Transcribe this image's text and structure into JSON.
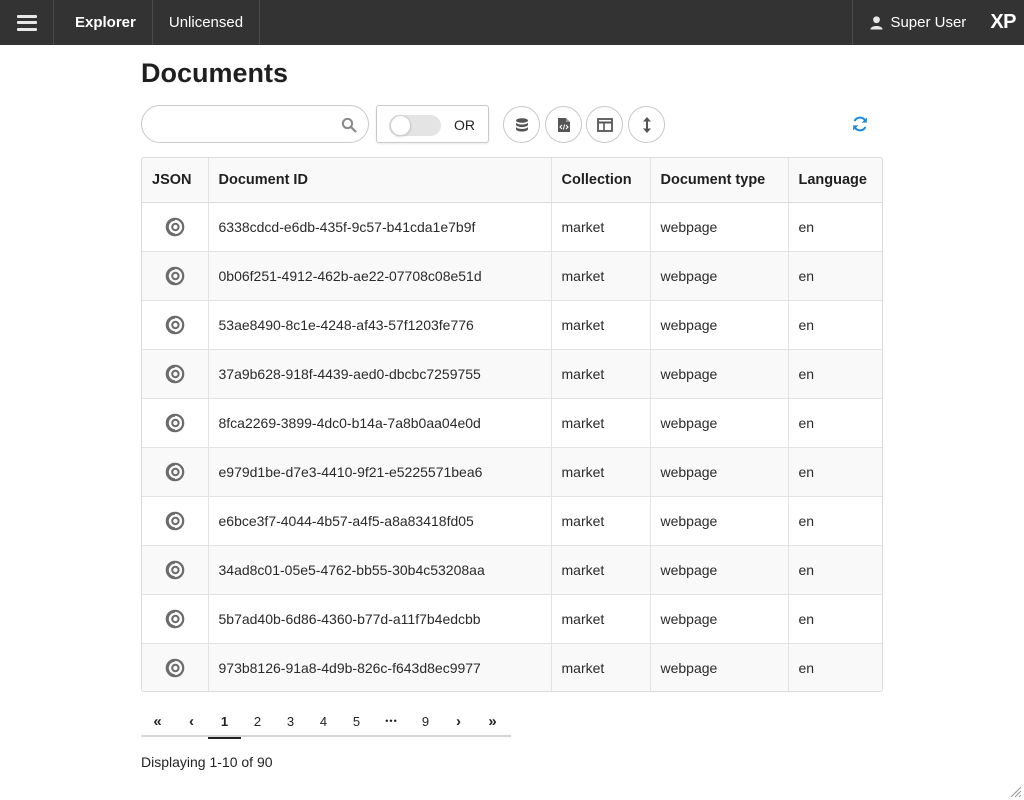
{
  "topbar": {
    "app_name": "Explorer",
    "license": "Unlicensed",
    "user": "Super User",
    "logo": "XP",
    "menu_icon": "hamburger-icon",
    "user_icon": "user-icon"
  },
  "page": {
    "title": "Documents"
  },
  "search": {
    "value": "",
    "placeholder": "",
    "icon": "search-icon"
  },
  "toggle": {
    "label": "OR",
    "checked": false
  },
  "toolbar_buttons": [
    {
      "name": "collections-button",
      "icon": "database-icon"
    },
    {
      "name": "document-types-button",
      "icon": "code-file-icon"
    },
    {
      "name": "columns-button",
      "icon": "columns-icon"
    },
    {
      "name": "sort-button",
      "icon": "sort-arrows-icon"
    }
  ],
  "refresh": {
    "icon": "refresh-icon"
  },
  "colors": {
    "topbar": "#333333",
    "accent": "#1d8ad8",
    "row_alt": "#f9f9f9"
  },
  "table": {
    "headers": {
      "json": "JSON",
      "id": "Document ID",
      "collection": "Collection",
      "type": "Document type",
      "language": "Language"
    },
    "rows": [
      {
        "id": "6338cdcd-e6db-435f-9c57-b41cda1e7b9f",
        "collection": "market",
        "type": "webpage",
        "language": "en"
      },
      {
        "id": "0b06f251-4912-462b-ae22-07708c08e51d",
        "collection": "market",
        "type": "webpage",
        "language": "en"
      },
      {
        "id": "53ae8490-8c1e-4248-af43-57f1203fe776",
        "collection": "market",
        "type": "webpage",
        "language": "en"
      },
      {
        "id": "37a9b628-918f-4439-aed0-dbcbc7259755",
        "collection": "market",
        "type": "webpage",
        "language": "en"
      },
      {
        "id": "8fca2269-3899-4dc0-b14a-7a8b0aa04e0d",
        "collection": "market",
        "type": "webpage",
        "language": "en"
      },
      {
        "id": "e979d1be-d7e3-4410-9f21-e5225571bea6",
        "collection": "market",
        "type": "webpage",
        "language": "en"
      },
      {
        "id": "e6bce3f7-4044-4b57-a4f5-a8a83418fd05",
        "collection": "market",
        "type": "webpage",
        "language": "en"
      },
      {
        "id": "34ad8c01-05e5-4762-bb55-30b4c53208aa",
        "collection": "market",
        "type": "webpage",
        "language": "en"
      },
      {
        "id": "5b7ad40b-6d86-4360-b77d-a11f7b4edcbb",
        "collection": "market",
        "type": "webpage",
        "language": "en"
      },
      {
        "id": "973b8126-91a8-4d9b-826c-f643d8ec9977",
        "collection": "market",
        "type": "webpage",
        "language": "en"
      }
    ]
  },
  "pagination": {
    "first": "«",
    "prev": "‹",
    "pages": [
      "1",
      "2",
      "3",
      "4",
      "5",
      "•••",
      "9"
    ],
    "active": "1",
    "next": "›",
    "last": "»",
    "summary": "Displaying 1-10 of 90"
  }
}
